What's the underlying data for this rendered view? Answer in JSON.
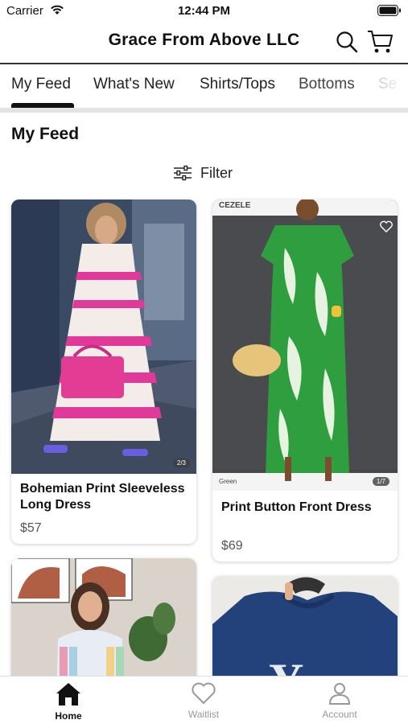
{
  "status_bar": {
    "carrier": "Carrier",
    "time": "12:44 PM"
  },
  "header": {
    "title": "Grace From Above LLC",
    "search_icon": "search-icon",
    "cart_icon": "cart-icon"
  },
  "tabs": [
    {
      "label": "My Feed",
      "active": true
    },
    {
      "label": "What's New",
      "active": false
    },
    {
      "label": "Shirts/Tops",
      "active": false
    },
    {
      "label": "Bottoms",
      "active": false
    },
    {
      "label": "Se",
      "active": false
    }
  ],
  "page_title": "My Feed",
  "filter": {
    "label": "Filter",
    "icon": "sliders-icon"
  },
  "products": [
    {
      "name": "Bohemian Print Sleeveless Long Dress",
      "price": "$57",
      "badge": "2/3"
    },
    {
      "name": "Print Button Front Dress",
      "price": "$69",
      "brand": "CEZELE",
      "color_label": "Green",
      "badge": "1/7"
    },
    {
      "name": "",
      "price": ""
    },
    {
      "name": "",
      "price": ""
    }
  ],
  "bottom_tabs": [
    {
      "label": "Home",
      "icon": "home-icon",
      "active": true
    },
    {
      "label": "Waitlist",
      "icon": "heart-icon",
      "active": false
    },
    {
      "label": "Account",
      "icon": "account-icon",
      "active": false
    }
  ],
  "colors": {
    "text": "#111111",
    "inactive": "#999999",
    "divider": "#e3e3e3"
  }
}
